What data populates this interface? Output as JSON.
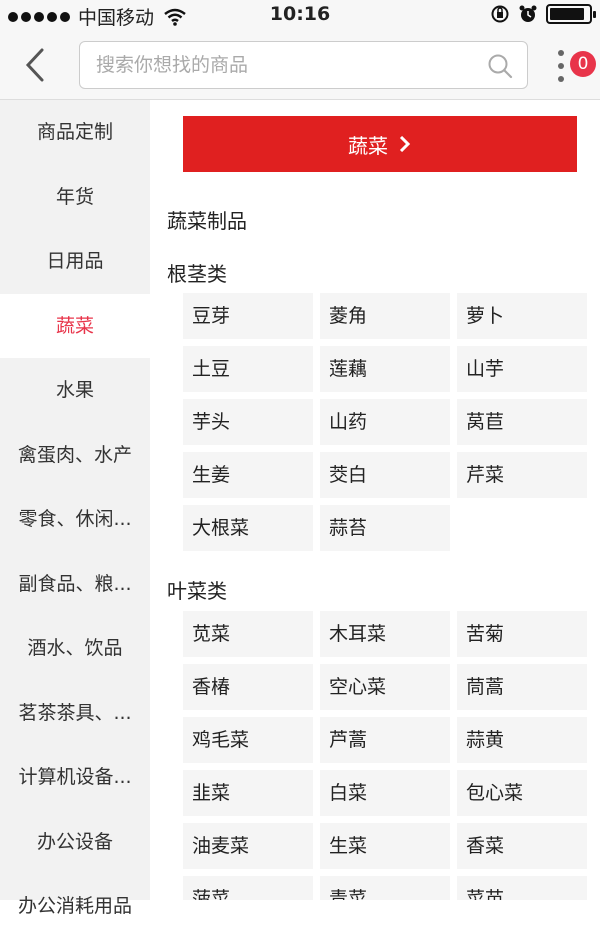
{
  "status_bar": {
    "carrier": "中国移动",
    "time": "10:16",
    "battery_level": 0.9
  },
  "header": {
    "search_placeholder": "搜索你想找的商品",
    "cart_badge": "0"
  },
  "sidebar": {
    "items": [
      {
        "label": "商品定制"
      },
      {
        "label": "年货"
      },
      {
        "label": "日用品"
      },
      {
        "label": "蔬菜"
      },
      {
        "label": "水果"
      },
      {
        "label": "禽蛋肉、水产"
      },
      {
        "label": "零食、休闲..."
      },
      {
        "label": "副食品、粮..."
      },
      {
        "label": "酒水、饮品"
      },
      {
        "label": "茗茶茶具、..."
      },
      {
        "label": "计算机设备..."
      },
      {
        "label": "办公设备"
      },
      {
        "label": "办公消耗用品"
      }
    ],
    "active": "蔬菜"
  },
  "content": {
    "banner_label": "蔬菜",
    "category_title": "蔬菜制品",
    "sections": [
      {
        "title": "根茎类",
        "items": [
          "豆芽",
          "菱角",
          "萝卜",
          "土豆",
          "莲藕",
          "山芋",
          "芋头",
          "山药",
          "莴苣",
          "生姜",
          "茭白",
          "芹菜",
          "大根菜",
          "蒜苔"
        ]
      },
      {
        "title": "叶菜类",
        "items": [
          "苋菜",
          "木耳菜",
          "苦菊",
          "香椿",
          "空心菜",
          "茼蒿",
          "鸡毛菜",
          "芦蒿",
          "蒜黄",
          "韭菜",
          "白菜",
          "包心菜",
          "油麦菜",
          "生菜",
          "香菜",
          "菠菜",
          "青菜",
          "菜苗"
        ]
      }
    ]
  },
  "colors": {
    "accent": "#e02020",
    "active_text": "#e8344a",
    "sidebar_bg": "#f2f2f2",
    "cell_bg": "#f5f5f5"
  }
}
